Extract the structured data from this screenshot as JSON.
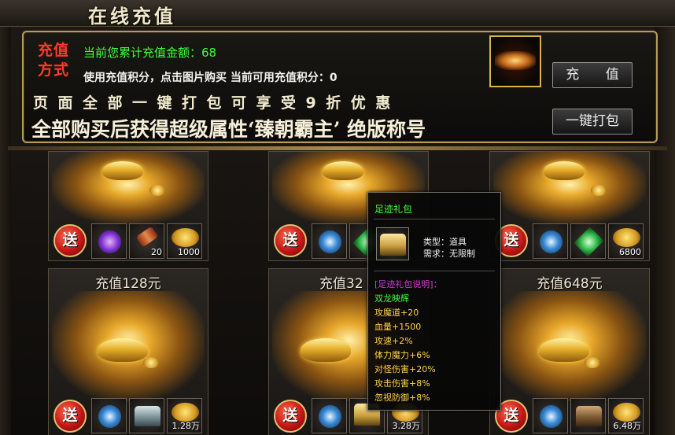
{
  "window": {
    "title": "在线充值"
  },
  "info": {
    "method_label_line1": "充值",
    "method_label_line2": "方式",
    "total_recharge_text": "当前您累计充值金额：68",
    "points_text": "使用充值积分，点击图片购买 当前可用充值积分：0",
    "discount_text": "页面全部一键打包可享受9折优惠",
    "title_reward_text": "全部购买后获得超级属性‘臻朝霸主’ 绝版称号"
  },
  "buttons": {
    "recharge": "充 值",
    "one_click_pack": "一键打包"
  },
  "top_row": {
    "cards": [
      {
        "items": [
          {
            "icon": "purple-gem-icon"
          },
          {
            "icon": "red-scroll-icon",
            "amount": "20"
          },
          {
            "icon": "gold-pile-icon",
            "amount": "1000"
          }
        ]
      },
      {
        "items": [
          {
            "icon": "blue-orb-icon"
          },
          {
            "icon": "green-crystal-icon"
          }
        ]
      },
      {
        "items": [
          {
            "icon": "blue-orb-icon"
          },
          {
            "icon": "green-crystal-icon"
          },
          {
            "icon": "gold-pile-icon",
            "amount": "6800"
          }
        ]
      }
    ]
  },
  "bottom_row": {
    "cards": [
      {
        "title": "充值128元",
        "items": [
          {
            "icon": "blue-orb-icon"
          },
          {
            "icon": "silver-chest-icon"
          },
          {
            "icon": "gold-pile-icon",
            "amount": "1.28万"
          }
        ]
      },
      {
        "title": "充值32",
        "items": [
          {
            "icon": "blue-orb-icon"
          },
          {
            "icon": "gold-chest-icon"
          },
          {
            "icon": "gold-pile-icon",
            "amount": "3.28万"
          }
        ]
      },
      {
        "title": "充值648元",
        "items": [
          {
            "icon": "blue-orb-icon"
          },
          {
            "icon": "brown-chest-icon"
          },
          {
            "icon": "gold-pile-icon",
            "amount": "6.48万"
          }
        ]
      }
    ]
  },
  "gift_badge": "送",
  "tooltip": {
    "title": "足迹礼包",
    "type_text": "类型：道具",
    "requirement_text": "需求：无限制",
    "desc_header": "[足迹礼包说明]：",
    "set_name": "双龙映辉",
    "stats": [
      "攻魔道+20",
      "血量+1500",
      "攻速+2%",
      "体力魔力+6%",
      "对怪伤害+20%",
      "攻击伤害+8%",
      "忽视防御+8%"
    ]
  },
  "colors": {
    "gold_border": "#b89a58",
    "green_text": "#3dff3d",
    "red_text": "#ff3a2a",
    "stat_text": "#ffd34a",
    "desc_text": "#d93ad9"
  }
}
